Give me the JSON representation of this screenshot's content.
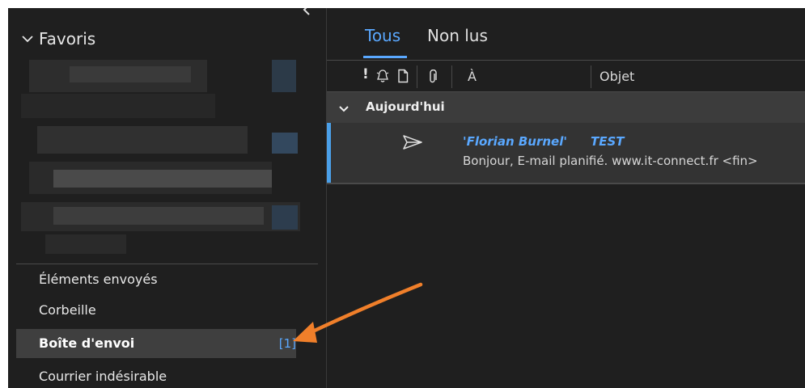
{
  "favorites": {
    "label": "Favoris"
  },
  "folders": [
    {
      "label": "Éléments envoyés"
    },
    {
      "label": "Corbeille"
    },
    {
      "label": "Boîte d'envoi",
      "count": "[1]",
      "selected": true
    },
    {
      "label": "Courrier indésirable"
    }
  ],
  "tabs": [
    {
      "label": "Tous",
      "active": true
    },
    {
      "label": "Non lus",
      "active": false
    }
  ],
  "columns": {
    "to": "À",
    "subject": "Objet"
  },
  "group": {
    "label": "Aujourd'hui"
  },
  "mail": {
    "from": "'Florian Burnel'",
    "subject": "TEST",
    "preview": "Bonjour,  E-mail planifié.  www.it-connect.fr <fin>"
  },
  "colors": {
    "accent": "#5aa8ff",
    "selection_bar": "#4a9fe8",
    "annotation_arrow": "#f07f2a",
    "background": "#1f1f1f"
  }
}
